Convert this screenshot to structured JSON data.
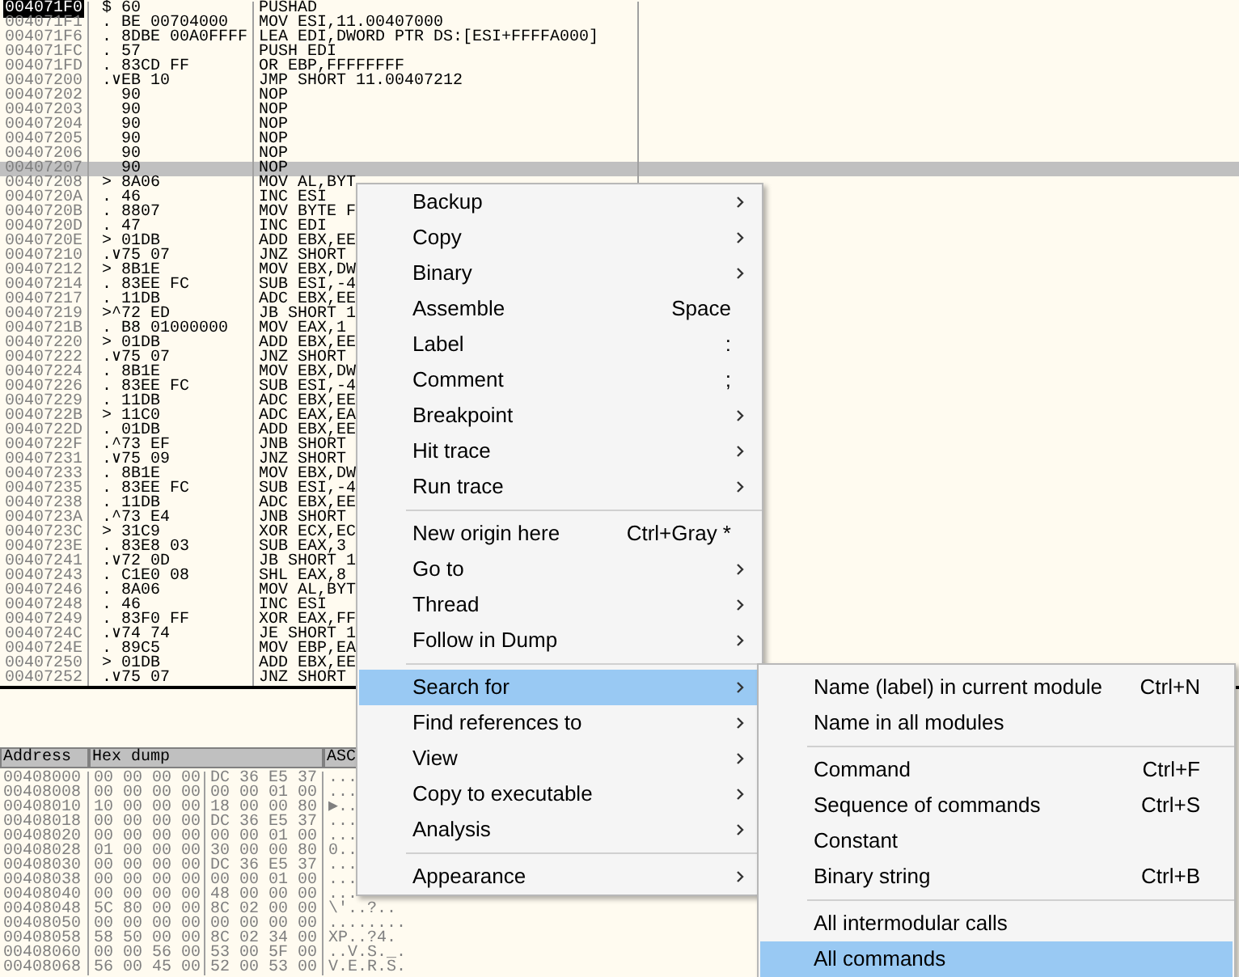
{
  "disassembly": {
    "rows": [
      {
        "address": "004071F0",
        "mark": "$",
        "hex": "60",
        "code": "PUSHAD",
        "current": true,
        "selected": false
      },
      {
        "address": "004071F1",
        "mark": ".",
        "hex": "BE 00704000",
        "code": "MOV ESI,11.00407000",
        "current": false,
        "selected": false
      },
      {
        "address": "004071F6",
        "mark": ".",
        "hex": "8DBE 00A0FFFF",
        "code": "LEA EDI,DWORD PTR DS:[ESI+FFFFA000]",
        "current": false,
        "selected": false
      },
      {
        "address": "004071FC",
        "mark": ".",
        "hex": "57",
        "code": "PUSH EDI",
        "current": false,
        "selected": false
      },
      {
        "address": "004071FD",
        "mark": ".",
        "hex": "83CD FF",
        "code": "OR EBP,FFFFFFFF",
        "current": false,
        "selected": false
      },
      {
        "address": "00407200",
        "mark": ".∨",
        "hex": "EB 10",
        "code": "JMP SHORT 11.00407212",
        "current": false,
        "selected": false
      },
      {
        "address": "00407202",
        "hex": "90",
        "code": "NOP",
        "current": false,
        "selected": false
      },
      {
        "address": "00407203",
        "hex": "90",
        "code": "NOP",
        "current": false,
        "selected": false
      },
      {
        "address": "00407204",
        "hex": "90",
        "code": "NOP",
        "current": false,
        "selected": false
      },
      {
        "address": "00407205",
        "hex": "90",
        "code": "NOP",
        "current": false,
        "selected": false
      },
      {
        "address": "00407206",
        "hex": "90",
        "code": "NOP",
        "current": false,
        "selected": false
      },
      {
        "address": "00407207",
        "hex": "90",
        "code": "NOP",
        "current": false,
        "selected": true
      },
      {
        "address": "00407208",
        "mark": ">",
        "hex": "8A06",
        "code": "MOV AL,BYT",
        "current": false,
        "selected": false
      },
      {
        "address": "0040720A",
        "mark": ".",
        "hex": "46",
        "code": "INC ESI",
        "current": false,
        "selected": false
      },
      {
        "address": "0040720B",
        "mark": ".",
        "hex": "8807",
        "code": "MOV BYTE F",
        "current": false,
        "selected": false
      },
      {
        "address": "0040720D",
        "mark": ".",
        "hex": "47",
        "code": "INC EDI",
        "current": false,
        "selected": false
      },
      {
        "address": "0040720E",
        "mark": ">",
        "hex": "01DB",
        "code": "ADD EBX,EE",
        "current": false,
        "selected": false
      },
      {
        "address": "00407210",
        "mark": ".∨",
        "hex": "75 07",
        "code": "JNZ SHORT",
        "current": false,
        "selected": false
      },
      {
        "address": "00407212",
        "mark": ">",
        "hex": "8B1E",
        "code": "MOV EBX,DW",
        "current": false,
        "selected": false
      },
      {
        "address": "00407214",
        "mark": ".",
        "hex": "83EE FC",
        "code": "SUB ESI,-4",
        "current": false,
        "selected": false
      },
      {
        "address": "00407217",
        "mark": ".",
        "hex": "11DB",
        "code": "ADC EBX,EE",
        "current": false,
        "selected": false
      },
      {
        "address": "00407219",
        "mark": ">^",
        "hex": "72 ED",
        "code": "JB SHORT 1",
        "current": false,
        "selected": false
      },
      {
        "address": "0040721B",
        "mark": ".",
        "hex": "B8 01000000",
        "code": "MOV EAX,1",
        "current": false,
        "selected": false
      },
      {
        "address": "00407220",
        "mark": ">",
        "hex": "01DB",
        "code": "ADD EBX,EE",
        "current": false,
        "selected": false
      },
      {
        "address": "00407222",
        "mark": ".∨",
        "hex": "75 07",
        "code": "JNZ SHORT",
        "current": false,
        "selected": false
      },
      {
        "address": "00407224",
        "mark": ".",
        "hex": "8B1E",
        "code": "MOV EBX,DW",
        "current": false,
        "selected": false
      },
      {
        "address": "00407226",
        "mark": ".",
        "hex": "83EE FC",
        "code": "SUB ESI,-4",
        "current": false,
        "selected": false
      },
      {
        "address": "00407229",
        "mark": ".",
        "hex": "11DB",
        "code": "ADC EBX,EE",
        "current": false,
        "selected": false
      },
      {
        "address": "0040722B",
        "mark": ">",
        "hex": "11C0",
        "code": "ADC EAX,EA",
        "current": false,
        "selected": false
      },
      {
        "address": "0040722D",
        "mark": ".",
        "hex": "01DB",
        "code": "ADD EBX,EE",
        "current": false,
        "selected": false
      },
      {
        "address": "0040722F",
        "mark": ".^",
        "hex": "73 EF",
        "code": "JNB SHORT",
        "current": false,
        "selected": false
      },
      {
        "address": "00407231",
        "mark": ".∨",
        "hex": "75 09",
        "code": "JNZ SHORT",
        "current": false,
        "selected": false
      },
      {
        "address": "00407233",
        "mark": ".",
        "hex": "8B1E",
        "code": "MOV EBX,DW",
        "current": false,
        "selected": false
      },
      {
        "address": "00407235",
        "mark": ".",
        "hex": "83EE FC",
        "code": "SUB ESI,-4",
        "current": false,
        "selected": false
      },
      {
        "address": "00407238",
        "mark": ".",
        "hex": "11DB",
        "code": "ADC EBX,EE",
        "current": false,
        "selected": false
      },
      {
        "address": "0040723A",
        "mark": ".^",
        "hex": "73 E4",
        "code": "JNB SHORT",
        "current": false,
        "selected": false
      },
      {
        "address": "0040723C",
        "mark": ">",
        "hex": "31C9",
        "code": "XOR ECX,EC",
        "current": false,
        "selected": false
      },
      {
        "address": "0040723E",
        "mark": ".",
        "hex": "83E8 03",
        "code": "SUB EAX,3",
        "current": false,
        "selected": false
      },
      {
        "address": "00407241",
        "mark": ".∨",
        "hex": "72 0D",
        "code": "JB SHORT 1",
        "current": false,
        "selected": false
      },
      {
        "address": "00407243",
        "mark": ".",
        "hex": "C1E0 08",
        "code": "SHL EAX,8",
        "current": false,
        "selected": false
      },
      {
        "address": "00407246",
        "mark": ".",
        "hex": "8A06",
        "code": "MOV AL,BYT",
        "current": false,
        "selected": false
      },
      {
        "address": "00407248",
        "mark": ".",
        "hex": "46",
        "code": "INC ESI",
        "current": false,
        "selected": false
      },
      {
        "address": "00407249",
        "mark": ".",
        "hex": "83F0 FF",
        "code": "XOR EAX,FF",
        "current": false,
        "selected": false
      },
      {
        "address": "0040724C",
        "mark": ".∨",
        "hex": "74 74",
        "code": "JE SHORT 1",
        "current": false,
        "selected": false
      },
      {
        "address": "0040724E",
        "mark": ".",
        "hex": "89C5",
        "code": "MOV EBP,EA",
        "current": false,
        "selected": false
      },
      {
        "address": "00407250",
        "mark": ">",
        "hex": "01DB",
        "code": "ADD EBX,EE",
        "current": false,
        "selected": false
      },
      {
        "address": "00407252",
        "mark": ".∨",
        "hex": "75 07",
        "code": "JNZ SHORT",
        "current": false,
        "selected": false
      }
    ]
  },
  "dump": {
    "columns": [
      "Address",
      "Hex dump",
      "ASC"
    ],
    "rows": [
      {
        "address": "00408000",
        "bytes_1": "00 00 00 00",
        "bytes_2": "DC 36 E5 37",
        "ascii": "..."
      },
      {
        "address": "00408008",
        "bytes_1": "00 00 00 00",
        "bytes_2": "00 00 01 00",
        "ascii": "..."
      },
      {
        "address": "00408010",
        "bytes_1": "10 00 00 00",
        "bytes_2": "18 00 00 80",
        "ascii": "▶.."
      },
      {
        "address": "00408018",
        "bytes_1": "00 00 00 00",
        "bytes_2": "DC 36 E5 37",
        "ascii": "..."
      },
      {
        "address": "00408020",
        "bytes_1": "00 00 00 00",
        "bytes_2": "00 00 01 00",
        "ascii": "..."
      },
      {
        "address": "00408028",
        "bytes_1": "01 00 00 00",
        "bytes_2": "30 00 00 80",
        "ascii": "0.."
      },
      {
        "address": "00408030",
        "bytes_1": "00 00 00 00",
        "bytes_2": "DC 36 E5 37",
        "ascii": "..."
      },
      {
        "address": "00408038",
        "bytes_1": "00 00 00 00",
        "bytes_2": "00 00 01 00",
        "ascii": "..."
      },
      {
        "address": "00408040",
        "bytes_1": "00 00 00 00",
        "bytes_2": "48 00 00 00",
        "ascii": "..."
      },
      {
        "address": "00408048",
        "bytes_1": "5C 80 00 00",
        "bytes_2": "8C 02 00 00",
        "ascii": "\\'..?.."
      },
      {
        "address": "00408050",
        "bytes_1": "00 00 00 00",
        "bytes_2": "00 00 00 00",
        "ascii": "........"
      },
      {
        "address": "00408058",
        "bytes_1": "58 50 00 00",
        "bytes_2": "8C 02 34 00",
        "ascii": "XP..?4."
      },
      {
        "address": "00408060",
        "bytes_1": "00 00 56 00",
        "bytes_2": "53 00 5F 00",
        "ascii": "..V.S._."
      },
      {
        "address": "00408068",
        "bytes_1": "56 00 45 00",
        "bytes_2": "52 00 53 00",
        "ascii": "V.E.R.S."
      }
    ]
  },
  "context_menu": {
    "items": [
      {
        "kind": "item",
        "label": "Backup",
        "submenu": true,
        "selected": false
      },
      {
        "kind": "item",
        "label": "Copy",
        "submenu": true,
        "selected": false
      },
      {
        "kind": "item",
        "label": "Binary",
        "submenu": true,
        "selected": false
      },
      {
        "kind": "item",
        "label": "Assemble",
        "shortcut": "Space",
        "submenu": false,
        "selected": false
      },
      {
        "kind": "item",
        "label": "Label",
        "shortcut": ":",
        "submenu": false,
        "selected": false
      },
      {
        "kind": "item",
        "label": "Comment",
        "shortcut": ";",
        "submenu": false,
        "selected": false
      },
      {
        "kind": "item",
        "label": "Breakpoint",
        "submenu": true,
        "selected": false
      },
      {
        "kind": "item",
        "label": "Hit trace",
        "submenu": true,
        "selected": false
      },
      {
        "kind": "item",
        "label": "Run trace",
        "submenu": true,
        "selected": false
      },
      {
        "kind": "separator"
      },
      {
        "kind": "item",
        "label": "New origin here",
        "shortcut": "Ctrl+Gray *",
        "submenu": false,
        "selected": false
      },
      {
        "kind": "item",
        "label": "Go to",
        "submenu": true,
        "selected": false
      },
      {
        "kind": "item",
        "label": "Thread",
        "submenu": true,
        "selected": false
      },
      {
        "kind": "item",
        "label": "Follow in Dump",
        "submenu": true,
        "selected": false
      },
      {
        "kind": "separator"
      },
      {
        "kind": "item",
        "label": "Search for",
        "submenu": true,
        "selected": true
      },
      {
        "kind": "item",
        "label": "Find references to",
        "submenu": true,
        "selected": false
      },
      {
        "kind": "item",
        "label": "View",
        "submenu": true,
        "selected": false
      },
      {
        "kind": "item",
        "label": "Copy to executable",
        "submenu": true,
        "selected": false
      },
      {
        "kind": "item",
        "label": "Analysis",
        "submenu": true,
        "selected": false
      },
      {
        "kind": "separator"
      },
      {
        "kind": "item",
        "label": "Appearance",
        "submenu": true,
        "selected": false
      }
    ]
  },
  "submenu": {
    "items": [
      {
        "kind": "item",
        "label": "Name (label) in current module",
        "shortcut": "Ctrl+N",
        "selected": false
      },
      {
        "kind": "item",
        "label": "Name in all modules",
        "selected": false
      },
      {
        "kind": "separator"
      },
      {
        "kind": "item",
        "label": "Command",
        "shortcut": "Ctrl+F",
        "selected": false
      },
      {
        "kind": "item",
        "label": "Sequence of commands",
        "shortcut": "Ctrl+S",
        "selected": false
      },
      {
        "kind": "item",
        "label": "Constant",
        "selected": false
      },
      {
        "kind": "item",
        "label": "Binary string",
        "shortcut": "Ctrl+B",
        "selected": false
      },
      {
        "kind": "separator"
      },
      {
        "kind": "item",
        "label": "All intermodular calls",
        "selected": false
      },
      {
        "kind": "item",
        "label": "All commands",
        "selected": true
      }
    ]
  }
}
